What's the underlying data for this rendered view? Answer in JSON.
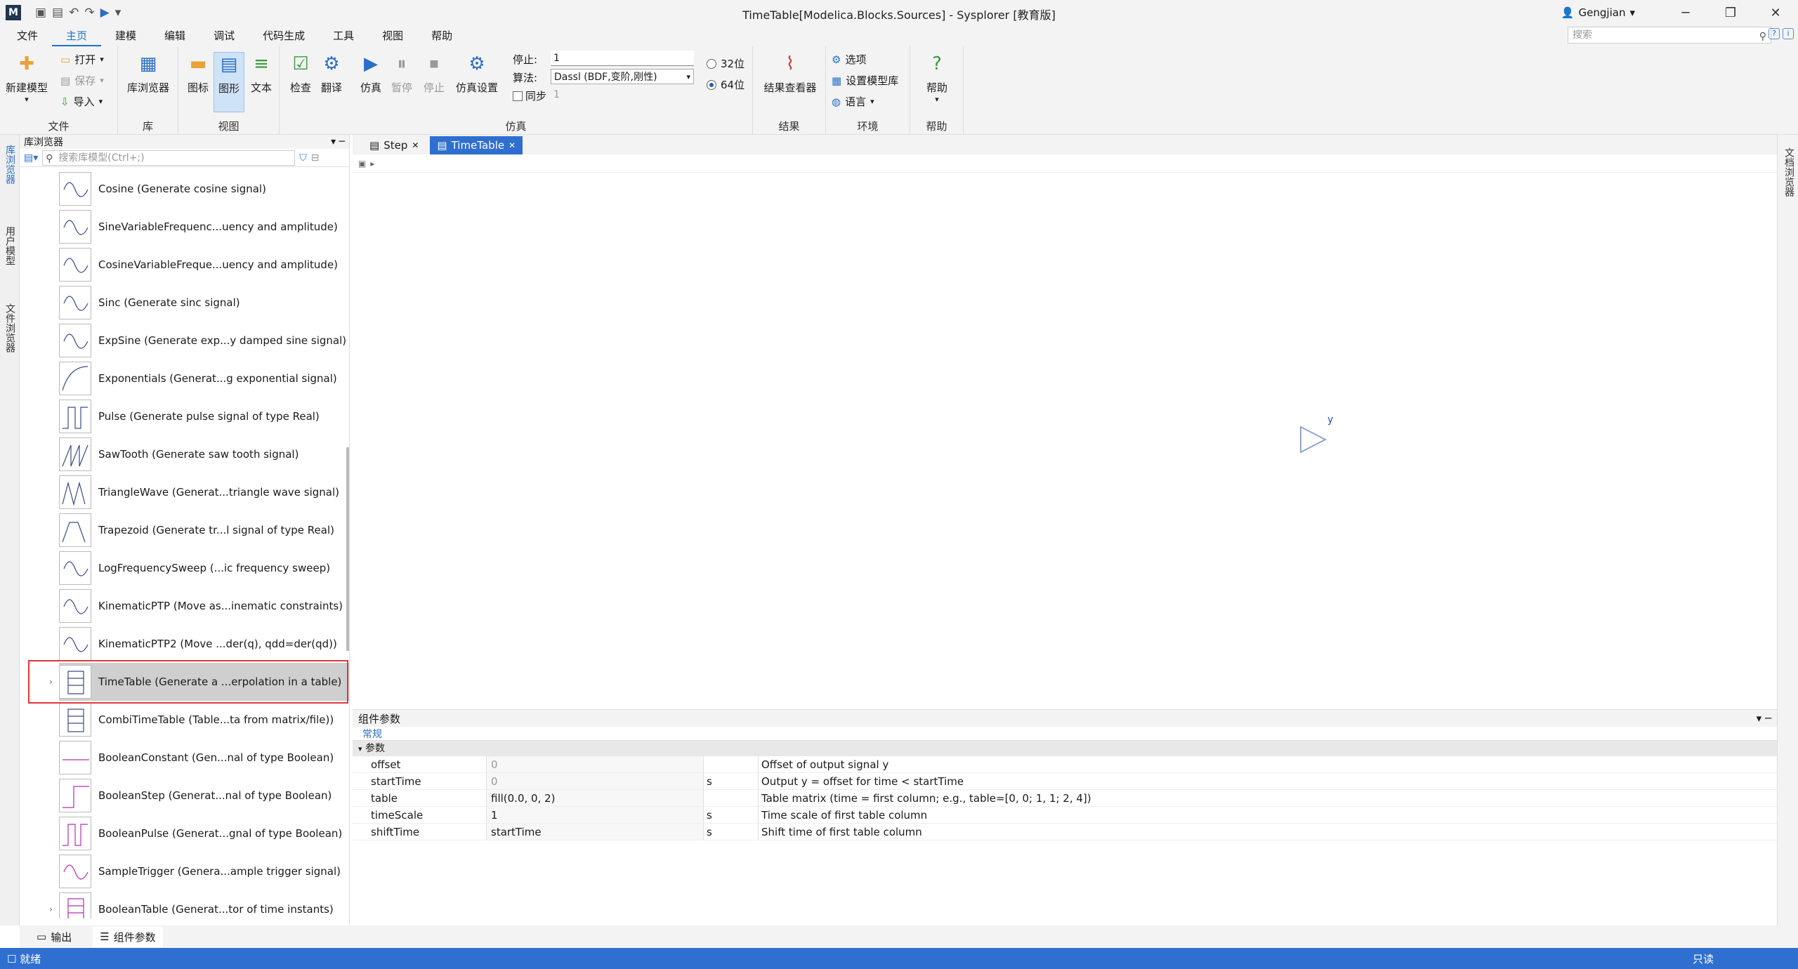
{
  "window": {
    "title": "TimeTable[Modelica.Blocks.Sources] - Sysplorer [教育版]",
    "user": "Gengjian",
    "app_logo": "M"
  },
  "menu": [
    "文件",
    "主页",
    "建模",
    "编辑",
    "调试",
    "代码生成",
    "工具",
    "视图",
    "帮助"
  ],
  "search": {
    "placeholder": "搜索"
  },
  "ribbon": {
    "file": {
      "new_model": "新建模型",
      "open": "打开",
      "save": "保存",
      "import": "导入",
      "group": "文件"
    },
    "lib": {
      "browser": "库浏览器",
      "group": "库"
    },
    "view": {
      "icon": "图标",
      "diagram": "图形",
      "text": "文本",
      "group": "视图"
    },
    "sim": {
      "check": "检查",
      "translate": "翻译",
      "simulate": "仿真",
      "pause": "暂停",
      "stop": "停止",
      "settings": "仿真设置",
      "stop_label": "停止:",
      "stop_value": "1",
      "algo_label": "算法:",
      "algo_value": "Dassl (BDF,变阶,刚性)",
      "sync_label": "同步",
      "sync_value": "1",
      "bit32": "32位",
      "bit64": "64位",
      "group": "仿真"
    },
    "result": {
      "viewer": "结果查看器",
      "group": "结果"
    },
    "env": {
      "options": "选项",
      "set_lib": "设置模型库",
      "language": "语言",
      "group": "环境"
    },
    "help": {
      "help": "帮助",
      "group": "帮助"
    }
  },
  "left_tabs": [
    "库浏览器",
    "用户模型",
    "文件浏览器"
  ],
  "right_tabs": [
    "文档浏览器"
  ],
  "library": {
    "title": "库浏览器",
    "search_placeholder": "搜索库模型(Ctrl+;)",
    "items": [
      "Cosine (Generate cosine signal)",
      "SineVariableFrequenc...uency and amplitude)",
      "CosineVariableFreque...uency and amplitude)",
      "Sinc (Generate sinc signal)",
      "ExpSine (Generate exp...y damped sine signal)",
      "Exponentials (Generat...g exponential signal)",
      "Pulse (Generate pulse signal of type Real)",
      "SawTooth (Generate saw tooth signal)",
      "TriangleWave (Generat...triangle wave signal)",
      "Trapezoid (Generate tr...l signal of type Real)",
      "LogFrequencySweep (...ic frequency sweep)",
      "KinematicPTP (Move as...inematic constraints)",
      "KinematicPTP2 (Move ...der(q), qdd=der(qd))",
      "TimeTable (Generate a ...erpolation in a table)",
      "CombiTimeTable (Table...ta from matrix/file))",
      "BooleanConstant (Gen...nal of type Boolean)",
      "BooleanStep (Generat...nal of type Boolean)",
      "BooleanPulse (Generat...gnal of type Boolean)",
      "SampleTrigger (Genera...ample trigger signal)",
      "BooleanTable (Generat...tor of time instants)"
    ]
  },
  "doc_tabs": [
    {
      "label": "Step"
    },
    {
      "label": "TimeTable"
    }
  ],
  "canvas": {
    "output_label": "y"
  },
  "params": {
    "title": "组件参数",
    "tab": "常规",
    "group": "参数",
    "rows": [
      {
        "name": "offset",
        "value": "0",
        "unit": "",
        "desc": "Offset of output signal y"
      },
      {
        "name": "startTime",
        "value": "0",
        "unit": "s",
        "desc": "Output y = offset for time < startTime"
      },
      {
        "name": "table",
        "value": "fill(0.0, 0, 2)",
        "unit": "",
        "desc": "Table matrix (time = first column; e.g., table=[0, 0; 1, 1; 2, 4])"
      },
      {
        "name": "timeScale",
        "value": "1",
        "unit": "s",
        "desc": "Time scale of first table column"
      },
      {
        "name": "shiftTime",
        "value": "startTime",
        "unit": "s",
        "desc": "Shift time of first table column"
      }
    ]
  },
  "bottom_tabs": [
    "输出",
    "组件参数"
  ],
  "status": {
    "left": "就绪",
    "right": "只读"
  }
}
